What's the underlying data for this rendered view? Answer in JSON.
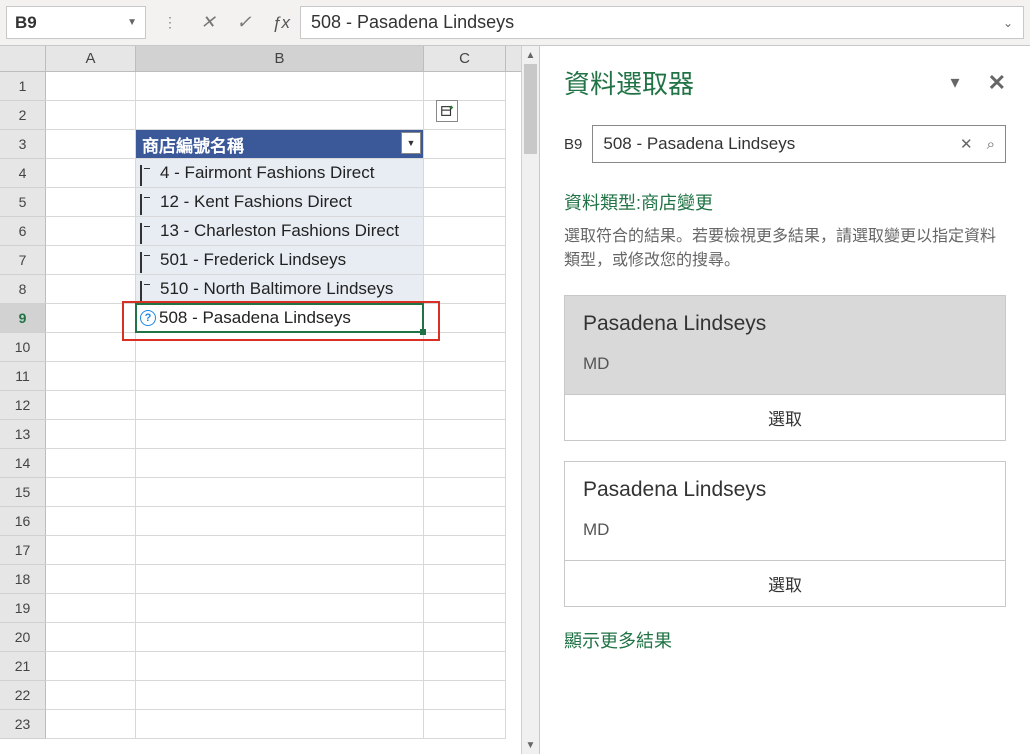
{
  "name_box": "B9",
  "formula_value": "508 - Pasadena Lindseys",
  "columns": [
    "A",
    "B",
    "C"
  ],
  "rows": [
    "1",
    "2",
    "3",
    "4",
    "5",
    "6",
    "7",
    "8",
    "9",
    "10",
    "11",
    "12",
    "13",
    "14",
    "15",
    "16",
    "17",
    "18",
    "19",
    "20",
    "21",
    "22",
    "23"
  ],
  "table": {
    "header": "商店編號名稱",
    "cells": [
      "4 - Fairmont Fashions Direct",
      "12 - Kent Fashions Direct",
      "13 - Charleston Fashions Direct",
      "501 - Frederick Lindseys",
      "510 - North Baltimore Lindseys",
      "508 - Pasadena Lindseys"
    ]
  },
  "panel": {
    "title": "資料選取器",
    "search_label": "B9",
    "search_value": "508 - Pasadena Lindseys",
    "type_label": "資料類型:商店變更",
    "description": "選取符合的結果。若要檢視更多結果，請選取變更以指定資料類型，或修改您的搜尋。",
    "results": [
      {
        "name": "Pasadena Lindseys",
        "sub": "MD",
        "select": "選取"
      },
      {
        "name": "Pasadena Lindseys",
        "sub": "MD",
        "select": "選取"
      }
    ],
    "more": "顯示更多結果"
  }
}
